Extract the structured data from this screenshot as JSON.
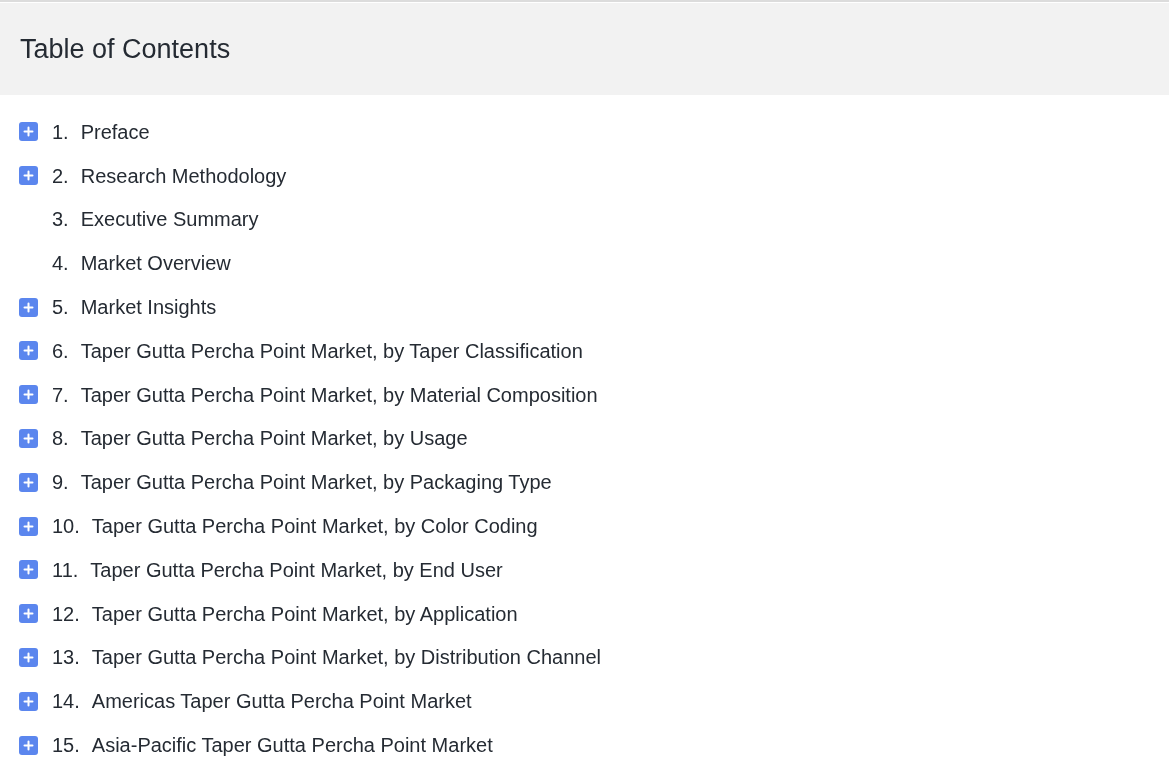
{
  "header": {
    "title": "Table of Contents"
  },
  "items": [
    {
      "number": "1.",
      "title": "Preface",
      "expandable": true
    },
    {
      "number": "2.",
      "title": "Research Methodology",
      "expandable": true
    },
    {
      "number": "3.",
      "title": "Executive Summary",
      "expandable": false
    },
    {
      "number": "4.",
      "title": "Market Overview",
      "expandable": false
    },
    {
      "number": "5.",
      "title": "Market Insights",
      "expandable": true
    },
    {
      "number": "6.",
      "title": "Taper Gutta Percha Point Market, by Taper Classification",
      "expandable": true
    },
    {
      "number": "7.",
      "title": "Taper Gutta Percha Point Market, by Material Composition",
      "expandable": true
    },
    {
      "number": "8.",
      "title": "Taper Gutta Percha Point Market, by Usage",
      "expandable": true
    },
    {
      "number": "9.",
      "title": "Taper Gutta Percha Point Market, by Packaging Type",
      "expandable": true
    },
    {
      "number": "10.",
      "title": "Taper Gutta Percha Point Market, by Color Coding",
      "expandable": true
    },
    {
      "number": "11.",
      "title": "Taper Gutta Percha Point Market, by End User",
      "expandable": true
    },
    {
      "number": "12.",
      "title": "Taper Gutta Percha Point Market, by Application",
      "expandable": true
    },
    {
      "number": "13.",
      "title": "Taper Gutta Percha Point Market, by Distribution Channel",
      "expandable": true
    },
    {
      "number": "14.",
      "title": "Americas Taper Gutta Percha Point Market",
      "expandable": true
    },
    {
      "number": "15.",
      "title": "Asia-Pacific Taper Gutta Percha Point Market",
      "expandable": true
    }
  ]
}
